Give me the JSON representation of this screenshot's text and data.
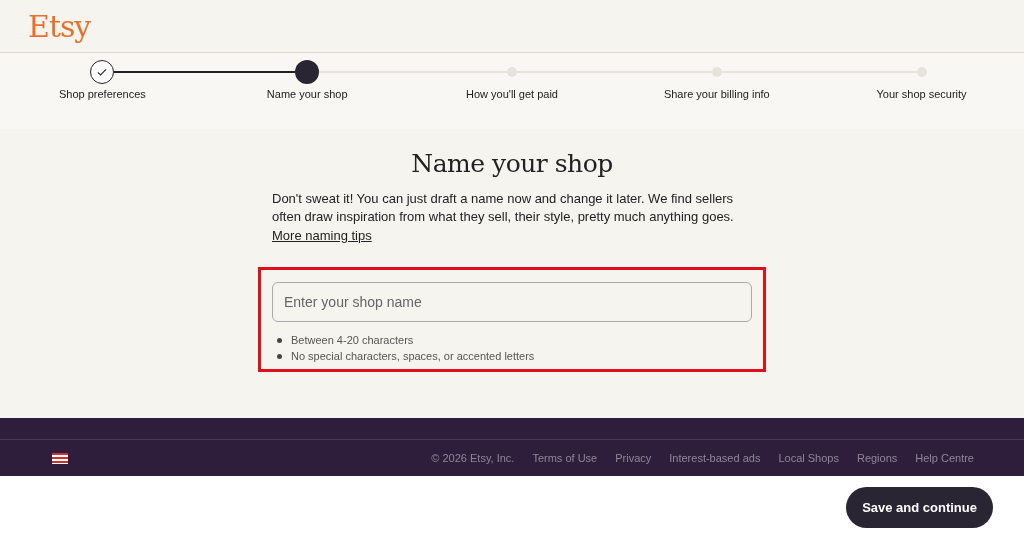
{
  "header": {
    "logo": "Etsy"
  },
  "steps": [
    {
      "label": "Shop preferences",
      "completed": true,
      "selected": false
    },
    {
      "label": "Name your shop",
      "completed": false,
      "selected": true
    },
    {
      "label": "How you'll get paid",
      "completed": false,
      "selected": false
    },
    {
      "label": "Share your billing info",
      "completed": false,
      "selected": false
    },
    {
      "label": "Your shop security",
      "completed": false,
      "selected": false
    }
  ],
  "main": {
    "title": "Name your shop",
    "description": "Don't sweat it! You can just draft a name now and change it later. We find sellers often draw inspiration from what they sell, their style, pretty much anything goes.",
    "link": "More naming tips",
    "field": {
      "placeholder": "Enter your shop name"
    },
    "rules": [
      "Between 4-20 characters",
      "No special characters, spaces, or accented letters"
    ]
  },
  "footer": {
    "links": [
      "© 2026 Etsy, Inc.",
      "Terms of Use",
      "Privacy",
      "Interest-based ads",
      "Local Shops",
      "Regions",
      "Help Centre"
    ]
  },
  "bottom_bar": {
    "button": "Save and continue"
  }
}
